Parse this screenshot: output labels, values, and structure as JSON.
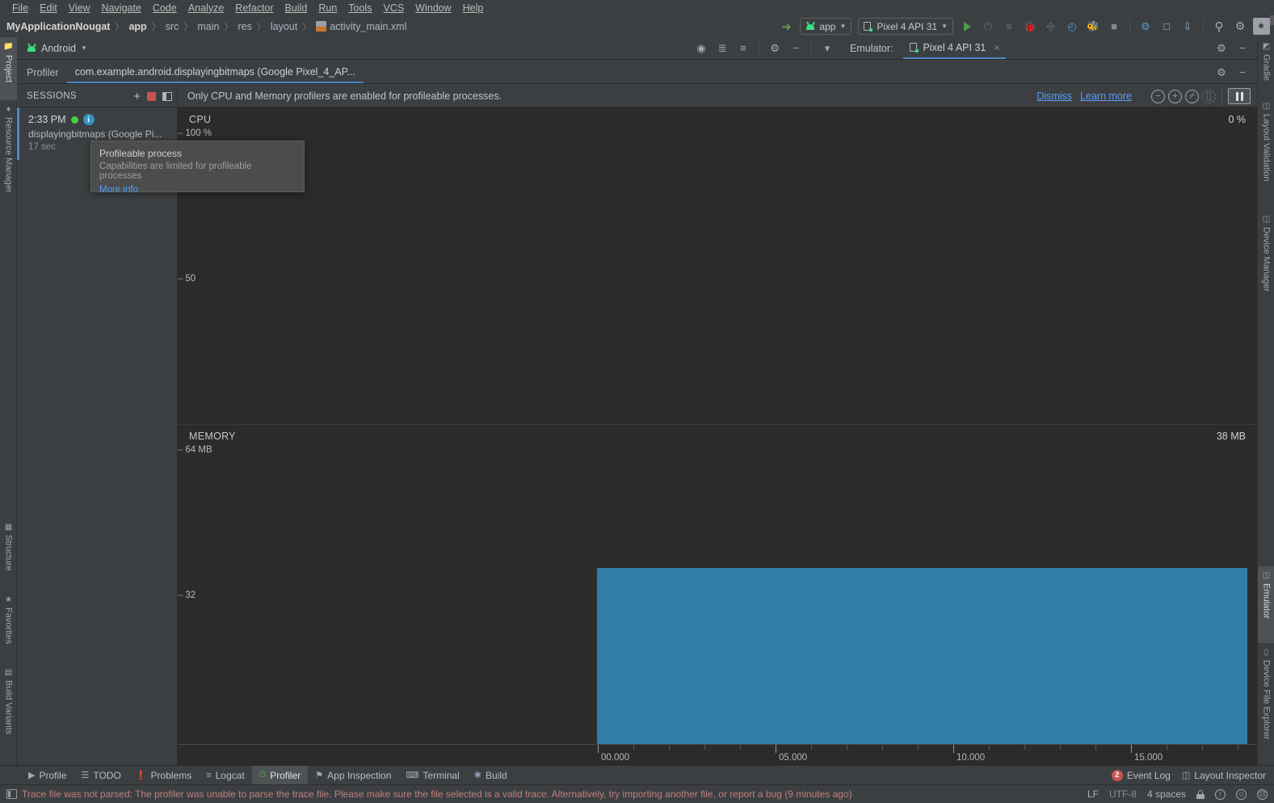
{
  "menu": {
    "items": [
      "File",
      "Edit",
      "View",
      "Navigate",
      "Code",
      "Analyze",
      "Refactor",
      "Build",
      "Run",
      "Tools",
      "VCS",
      "Window",
      "Help"
    ]
  },
  "breadcrumb": {
    "project": "MyApplicationNougat",
    "items": [
      "app",
      "src",
      "main",
      "res",
      "layout"
    ],
    "file": "activity_main.xml",
    "separator": "〉"
  },
  "toolbar": {
    "back_arrow": "↖",
    "module_selector": "app",
    "device_selector": "Pixel 4 API 31",
    "run": "run-button",
    "debug": "debug-button",
    "profile": "profile-button",
    "stop": "stop-button",
    "search": "⌕",
    "settings": "⚙"
  },
  "left_strip": {
    "tabs": [
      {
        "label": "Project",
        "icon": "■",
        "active": true
      },
      {
        "label": "Resource Manager",
        "icon": "❖",
        "active": false
      },
      {
        "label": "Structure",
        "icon": "☷",
        "active": false
      },
      {
        "label": "Favorites",
        "icon": "★",
        "active": false
      },
      {
        "label": "Build Variants",
        "icon": "▤",
        "active": false
      }
    ]
  },
  "right_strip": {
    "tabs": [
      {
        "label": "Gradle",
        "icon": "🐘",
        "active": false
      },
      {
        "label": "Layout Validation",
        "icon": "▧",
        "active": false
      },
      {
        "label": "Device Manager",
        "icon": "▧",
        "active": false
      },
      {
        "label": "Emulator",
        "icon": "▧",
        "active": true
      },
      {
        "label": "Device File Explorer",
        "icon": "▯",
        "active": false
      }
    ]
  },
  "tool_window": {
    "title": "Android",
    "caret": "▾",
    "emulator_label": "Emulator:",
    "emulator_tab": "Pixel 4 API 31",
    "close": "×"
  },
  "profiler": {
    "label": "Profiler",
    "tab": "com.example.android.displayingbitmaps (Google Pixel_4_AP...",
    "sessions": {
      "title": "SESSIONS",
      "add": "+",
      "stop": "stop-icon",
      "panel": "panel-icon",
      "item": {
        "time": "2:33 PM",
        "name": "displayingbitmaps (Google Pi...",
        "duration": "17 sec",
        "info_glyph": "i"
      }
    },
    "tooltip": {
      "title": "Profileable process",
      "subtitle": "Capabilities are limited for profileable processes",
      "link": "More info"
    },
    "notification": {
      "message": "Only CPU and Memory profilers are enabled for profileable processes.",
      "dismiss": "Dismiss",
      "learn_more": "Learn more",
      "zoom_out": "−",
      "zoom_in": "+",
      "reset_zoom": "⦸",
      "goto_live": "[ ]",
      "pause": "pause-icon"
    }
  },
  "chart_data": [
    {
      "type": "area",
      "title": "CPU",
      "ylabel": "100 %",
      "mid_label": "50",
      "current_value": "0 %",
      "ylim": [
        0,
        100
      ],
      "xlim": [
        0,
        17
      ],
      "x": [
        0,
        17
      ],
      "values": [
        0,
        0
      ],
      "grid": false,
      "legend": "none",
      "color": "#3282ad"
    },
    {
      "type": "area",
      "title": "MEMORY",
      "ylabel": "64 MB",
      "mid_label": "32",
      "current_value": "38 MB",
      "ylim": [
        0,
        64
      ],
      "xlim": [
        0,
        17
      ],
      "x": [
        0,
        8.1,
        8.15,
        17
      ],
      "values": [
        0,
        0,
        38,
        38
      ],
      "grid": false,
      "legend": "none",
      "color": "#3282ad"
    }
  ],
  "timeline": {
    "labels": [
      "00.000",
      "05.000",
      "10.000",
      "15.000"
    ],
    "label_positions": [
      520,
      740,
      960,
      1180
    ],
    "tick_spacing": 44,
    "tick_start": 520
  },
  "bottom_tabs": {
    "items": [
      {
        "label": "Profile",
        "icon": "▶",
        "active": false
      },
      {
        "label": "TODO",
        "icon": "☰",
        "active": false
      },
      {
        "label": "Problems",
        "icon": "❗",
        "active": false
      },
      {
        "label": "Logcat",
        "icon": "≡",
        "active": false
      },
      {
        "label": "Profiler",
        "icon": "↗",
        "active": true
      },
      {
        "label": "App Inspection",
        "icon": "⚑",
        "active": false
      },
      {
        "label": "Terminal",
        "icon": "⌫",
        "active": false
      },
      {
        "label": "Build",
        "icon": "🔨",
        "active": false
      }
    ],
    "right": {
      "event_log": "Event Log",
      "event_log_badge": "2",
      "layout_inspector": "Layout Inspector"
    }
  },
  "status_bar": {
    "message": "Trace file was not parsed: The profiler was unable to parse the trace file. Please make sure the file selected is a valid trace. Alternatively, try importing another file, or report a bug (9 minutes ago)",
    "line_ending": "LF",
    "encoding": "UTF-8",
    "indent": "4 spaces",
    "lock": "lock-icon",
    "notifications": "❗",
    "happy": "☺",
    "sad": "☹"
  },
  "colors": {
    "accent": "#4a88c7",
    "memory_series": "#3282ad",
    "link": "#589df6",
    "error_text": "#c07f7f",
    "green": "#3ddc84",
    "red": "#c75450",
    "panel_bg": "#3c3f41",
    "chart_bg": "#2b2b2b"
  }
}
